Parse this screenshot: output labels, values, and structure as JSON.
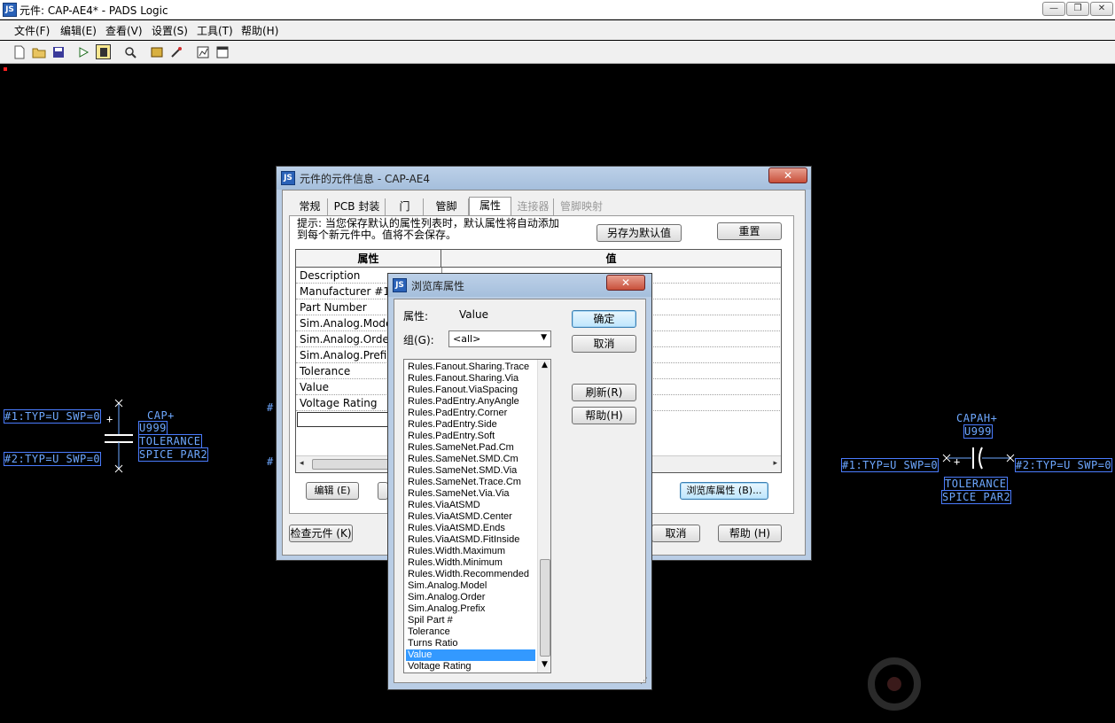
{
  "window": {
    "title": "元件: CAP-AE4* - PADS Logic",
    "app_icon": "JS",
    "minimize": "—",
    "restore": "❐",
    "close": "✕"
  },
  "menu": [
    "文件(F)",
    "编辑(E)",
    "查看(V)",
    "设置(S)",
    "工具(T)",
    "帮助(H)"
  ],
  "toolbar": {
    "icons": [
      "new-file-icon",
      "open-folder-icon",
      "save-icon",
      "gate-icon",
      "part-icon",
      "zoom-icon",
      "library-icon",
      "wizard-icon",
      "report-icon",
      "window-icon"
    ]
  },
  "canvas": {
    "left_part": {
      "pin1": "#1:TYP=U SWP=0",
      "pin2": "#2:TYP=U SWP=0",
      "name": "CAP+",
      "ref": "U999",
      "attr1": "TOLERANCE",
      "attr2": "SPICE PAR2",
      "plus": "+"
    },
    "right_part": {
      "pin1": "#1:TYP=U SWP=0",
      "pin2": "#2:TYP=U SWP=0",
      "name": "CAPAH+",
      "ref": "U999",
      "attr1": "TOLERANCE",
      "attr2": "SPICE PAR2",
      "plus": "+"
    },
    "stub_hash": "#"
  },
  "part_dialog": {
    "title": "元件的元件信息 - CAP-AE4",
    "close": "✕",
    "tabs": [
      {
        "label": "常规",
        "state": "normal"
      },
      {
        "label": "PCB 封装",
        "state": "normal"
      },
      {
        "label": "门",
        "state": "normal"
      },
      {
        "label": "管脚",
        "state": "normal"
      },
      {
        "label": "属性",
        "state": "active"
      },
      {
        "label": "连接器",
        "state": "disabled"
      },
      {
        "label": "管脚映射",
        "state": "disabled"
      }
    ],
    "hint_line1": "提示: 当您保存默认的属性列表时，默认属性将自动添加",
    "hint_line2": "到每个新元件中。值将不会保存。",
    "save_default_button": "另存为默认值",
    "reset_button": "重置",
    "table_headers": {
      "attribute": "属性",
      "value": "值"
    },
    "attributes": [
      "Description",
      "Manufacturer #1",
      "Part Number",
      "Sim.Analog.Model",
      "Sim.Analog.Order",
      "Sim.Analog.Prefix",
      "Tolerance",
      "Value",
      "Voltage Rating"
    ],
    "edit_button": "编辑 (E)",
    "browse_button": "浏览库属性 (B)...",
    "check_button": "检查元件 (K)",
    "cancel_button": "取消",
    "help_button": "帮助 (H)"
  },
  "browse_dialog": {
    "title": "浏览库属性",
    "close": "✕",
    "attr_label": "属性:",
    "attr_value": "Value",
    "group_label": "组(G):",
    "group_value": "<all>",
    "ok_button": "确定",
    "cancel_button": "取消",
    "refresh_button": "刷新(R)",
    "help_button": "帮助(H)",
    "items": [
      "Rules.Fanout.Sharing.Trace",
      "Rules.Fanout.Sharing.Via",
      "Rules.Fanout.ViaSpacing",
      "Rules.PadEntry.AnyAngle",
      "Rules.PadEntry.Corner",
      "Rules.PadEntry.Side",
      "Rules.PadEntry.Soft",
      "Rules.SameNet.Pad.Cm",
      "Rules.SameNet.SMD.Cm",
      "Rules.SameNet.SMD.Via",
      "Rules.SameNet.Trace.Cm",
      "Rules.SameNet.Via.Via",
      "Rules.ViaAtSMD",
      "Rules.ViaAtSMD.Center",
      "Rules.ViaAtSMD.Ends",
      "Rules.ViaAtSMD.FitInside",
      "Rules.Width.Maximum",
      "Rules.Width.Minimum",
      "Rules.Width.Recommended",
      "Sim.Analog.Model",
      "Sim.Analog.Order",
      "Sim.Analog.Prefix",
      "Spil Part #",
      "Tolerance",
      "Turns Ratio",
      "Value",
      "Voltage Rating"
    ],
    "selected_item": "Value"
  }
}
